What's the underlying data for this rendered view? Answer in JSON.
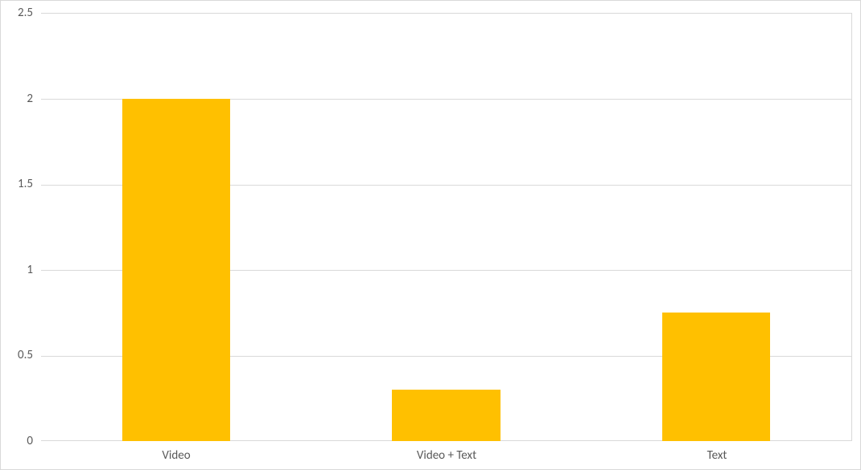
{
  "chart_data": {
    "type": "bar",
    "categories": [
      "Video",
      "Video + Text",
      "Text"
    ],
    "values": [
      2.0,
      0.3,
      0.75
    ],
    "title": "",
    "xlabel": "",
    "ylabel": "",
    "ylim": [
      0,
      2.5
    ],
    "yticks": [
      0,
      0.5,
      1,
      1.5,
      2,
      2.5
    ],
    "ytick_labels": [
      "0",
      "0.5",
      "1",
      "1.5",
      "2",
      "2.5"
    ],
    "bar_color": "#ffc000",
    "grid_color": "#d9d9d9"
  }
}
